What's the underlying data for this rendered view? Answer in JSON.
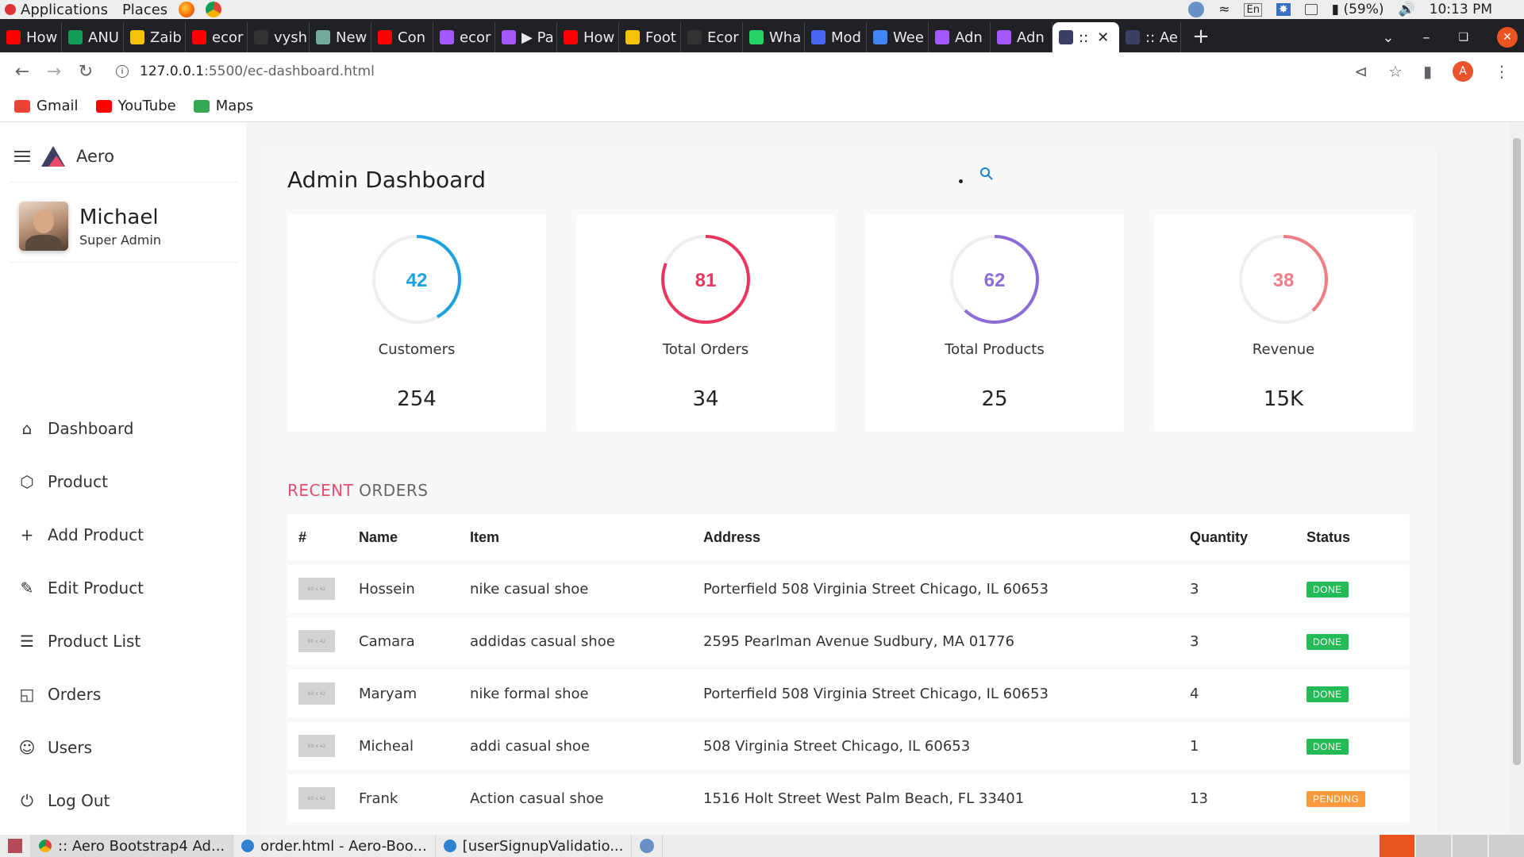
{
  "os_bar": {
    "applications": "Applications",
    "places": "Places",
    "battery": "(59%)",
    "time": "10:13 PM",
    "keyboard": "En"
  },
  "tabs": [
    {
      "label": "How",
      "color": "#ff0000"
    },
    {
      "label": "ANU",
      "color": "#0f9d58"
    },
    {
      "label": "Zaib",
      "color": "#f4c20d"
    },
    {
      "label": "ecor",
      "color": "#ff0000"
    },
    {
      "label": "vysh",
      "color": "#333333"
    },
    {
      "label": "New",
      "color": "#74aa9c"
    },
    {
      "label": "Con",
      "color": "#ff0000"
    },
    {
      "label": "ecor",
      "color": "#a259ff"
    },
    {
      "label": "▶ Pa",
      "color": "#a259ff"
    },
    {
      "label": "How",
      "color": "#ff0000"
    },
    {
      "label": "Foot",
      "color": "#f4c20d"
    },
    {
      "label": "Ecor",
      "color": "#333333"
    },
    {
      "label": "Wha",
      "color": "#25d366"
    },
    {
      "label": "Mod",
      "color": "#4a67f5"
    },
    {
      "label": "Wee",
      "color": "#4285f4"
    },
    {
      "label": "Adn",
      "color": "#a259ff"
    },
    {
      "label": "Adn",
      "color": "#a259ff"
    },
    {
      "label": ":: ",
      "color": "#3b3f63",
      "active": true
    },
    {
      "label": ":: Ae",
      "color": "#3b3f63"
    }
  ],
  "address": {
    "host": "127.0.0.1",
    "path": ":5500/ec-dashboard.html"
  },
  "bookmarks": [
    {
      "label": "Gmail",
      "color": "#ea4335"
    },
    {
      "label": "YouTube",
      "color": "#ff0000"
    },
    {
      "label": "Maps",
      "color": "#34a853"
    }
  ],
  "sidebar": {
    "brand": "Aero",
    "user_name": "Michael",
    "user_role": "Super Admin",
    "items": [
      {
        "label": "Dashboard",
        "icon": "home-icon"
      },
      {
        "label": "Product",
        "icon": "box-icon"
      },
      {
        "label": "Add Product",
        "icon": "plus-icon"
      },
      {
        "label": "Edit Product",
        "icon": "edit-icon"
      },
      {
        "label": "Product List",
        "icon": "list-icon"
      },
      {
        "label": "Orders",
        "icon": "cart-icon"
      },
      {
        "label": "Users",
        "icon": "user-icon"
      },
      {
        "label": "Log Out",
        "icon": "power-icon"
      }
    ]
  },
  "dashboard": {
    "title": "Admin Dashboard",
    "stats": [
      {
        "number": "42",
        "label": "Customers",
        "value": "254",
        "color": "#1ba1e2",
        "percent": 42
      },
      {
        "number": "81",
        "label": "Total Orders",
        "value": "34",
        "color": "#e8365d",
        "percent": 81
      },
      {
        "number": "62",
        "label": "Total Products",
        "value": "25",
        "color": "#8b6cd6",
        "percent": 62
      },
      {
        "number": "38",
        "label": "Revenue",
        "value": "15K",
        "color": "#f07c85",
        "percent": 38
      }
    ]
  },
  "recent_orders": {
    "title_accent": "RECENT",
    "title_rest": " ORDERS",
    "headers": [
      "#",
      "Name",
      "Item",
      "Address",
      "Quantity",
      "Status"
    ],
    "thumb_label": "80 x 42",
    "rows": [
      {
        "name": "Hossein",
        "item": "nike casual shoe",
        "address": "Porterfield 508 Virginia Street Chicago, IL 60653",
        "quantity": "3",
        "status": "DONE",
        "status_color": "#22bb55"
      },
      {
        "name": "Camara",
        "item": "addidas casual shoe",
        "address": "2595 Pearlman Avenue Sudbury, MA 01776",
        "quantity": "3",
        "status": "DONE",
        "status_color": "#22bb55"
      },
      {
        "name": "Maryam",
        "item": "nike formal shoe",
        "address": "Porterfield 508 Virginia Street Chicago, IL 60653",
        "quantity": "4",
        "status": "DONE",
        "status_color": "#22bb55"
      },
      {
        "name": "Micheal",
        "item": "addi casual shoe",
        "address": "508 Virginia Street Chicago, IL 60653",
        "quantity": "1",
        "status": "DONE",
        "status_color": "#22bb55"
      },
      {
        "name": "Frank",
        "item": "Action casual shoe",
        "address": "1516 Holt Street West Palm Beach, FL 33401",
        "quantity": "13",
        "status": "PENDING",
        "status_color": "#ff9a3c"
      }
    ]
  },
  "taskbar": [
    {
      "label": ":: Aero Bootstrap4 Ad...",
      "active": true
    },
    {
      "label": "order.html - Aero-Boo..."
    },
    {
      "label": "[userSignupValidatio..."
    }
  ]
}
